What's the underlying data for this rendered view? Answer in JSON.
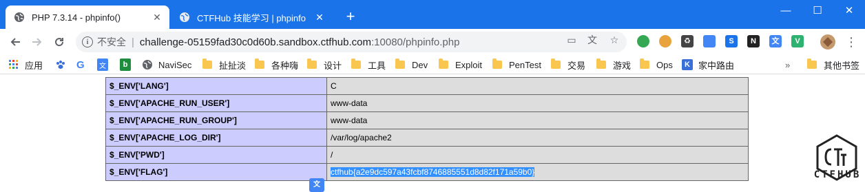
{
  "browser": {
    "tabs": [
      {
        "title": "PHP 7.3.14 - phpinfo()",
        "active": true
      },
      {
        "title": "CTFHub 技能学习 | phpinfo",
        "active": false
      }
    ],
    "new_tab_label": "+",
    "window_controls": {
      "minimize": "—",
      "maximize": "☐",
      "close": "✕"
    }
  },
  "omnibox": {
    "security_label": "不安全",
    "separator": "|",
    "url_host": "challenge-05159fad30c0d60b.sandbox.ctfhub.com",
    "url_rest": ":10080/phpinfo.php"
  },
  "extensions": [
    {
      "name": "ext-green-circle",
      "color": "#34a853",
      "glyph": ""
    },
    {
      "name": "ext-cookie",
      "color": "#e8a33d",
      "glyph": ""
    },
    {
      "name": "ext-recycle",
      "color": "#444444",
      "glyph": "♻"
    },
    {
      "name": "ext-shield",
      "color": "#4285f4",
      "glyph": ""
    },
    {
      "name": "ext-s",
      "color": "#1a73e8",
      "glyph": "S"
    },
    {
      "name": "ext-notion",
      "color": "#222222",
      "glyph": "N"
    },
    {
      "name": "ext-translate",
      "color": "#4285f4",
      "glyph": "文"
    },
    {
      "name": "ext-vue",
      "color": "#2db36f",
      "glyph": "V"
    }
  ],
  "bookmarks": {
    "apps": "应用",
    "items": [
      "NaviSec",
      "扯扯淡",
      "各种嗨",
      "设计",
      "工具",
      "Dev",
      "Exploit",
      "PenTest",
      "交易",
      "游戏",
      "Ops",
      "家中路由"
    ],
    "overflow": "»",
    "other": "其他书签"
  },
  "phpinfo": {
    "rows": [
      {
        "key": "$_ENV['LANG']",
        "value": "C"
      },
      {
        "key": "$_ENV['APACHE_RUN_USER']",
        "value": "www-data"
      },
      {
        "key": "$_ENV['APACHE_RUN_GROUP']",
        "value": "www-data"
      },
      {
        "key": "$_ENV['APACHE_LOG_DIR']",
        "value": "/var/log/apache2"
      },
      {
        "key": "$_ENV['PWD']",
        "value": "/"
      },
      {
        "key": "$_ENV['FLAG']",
        "value": "ctfhub{a2e9dc597a43fcbf8746885551d8d82f171a59b0}"
      }
    ]
  },
  "logo": {
    "wordmark": "CTFHUB"
  },
  "colors": {
    "chrome_blue": "#1a73e8",
    "env_key_bg": "#ccccff",
    "env_val_bg": "#dddddd",
    "selection": "#3390ff"
  }
}
